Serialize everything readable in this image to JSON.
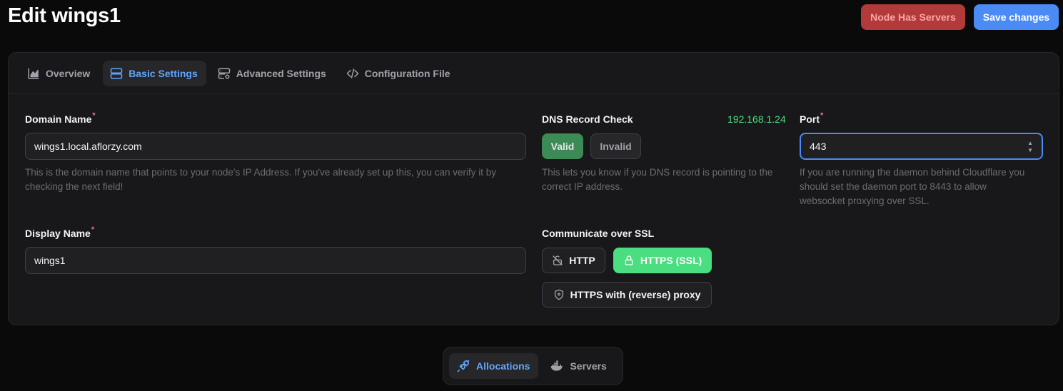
{
  "header": {
    "title": "Edit wings1",
    "node_has_servers_label": "Node Has Servers",
    "save_label": "Save changes"
  },
  "tabs": [
    {
      "label": "Overview",
      "icon": "chart-area-icon"
    },
    {
      "label": "Basic Settings",
      "icon": "server-icon",
      "active": true
    },
    {
      "label": "Advanced Settings",
      "icon": "server-cog-icon"
    },
    {
      "label": "Configuration File",
      "icon": "code-icon"
    }
  ],
  "domain": {
    "label": "Domain Name",
    "required_mark": "*",
    "value": "wings1.local.aflorzy.com",
    "hint": "This is the domain name that points to your node's IP Address. If you've already set up this, you can verify it by checking the next field!"
  },
  "dns": {
    "label": "DNS Record Check",
    "ip": "192.168.1.24",
    "valid_label": "Valid",
    "invalid_label": "Invalid",
    "hint": "This lets you know if you DNS record is pointing to the correct IP address."
  },
  "port": {
    "label": "Port",
    "required_mark": "*",
    "value": "443",
    "hint": "If you are running the daemon behind Cloudflare you should set the daemon port to 8443 to allow websocket proxying over SSL."
  },
  "display_name": {
    "label": "Display Name",
    "required_mark": "*",
    "value": "wings1"
  },
  "ssl": {
    "label": "Communicate over SSL",
    "http_label": "HTTP",
    "https_label": "HTTPS (SSL)",
    "proxy_label": "HTTPS with (reverse) proxy",
    "selected": "HTTPS (SSL)"
  },
  "bottom_tabs": [
    {
      "label": "Allocations",
      "icon": "plug-icon",
      "active": true
    },
    {
      "label": "Servers",
      "icon": "docker-icon"
    }
  ],
  "colors": {
    "accent": "#60a5fa",
    "primary": "#4b8bf5",
    "danger": "#b33a3a",
    "success": "#4ade80"
  }
}
